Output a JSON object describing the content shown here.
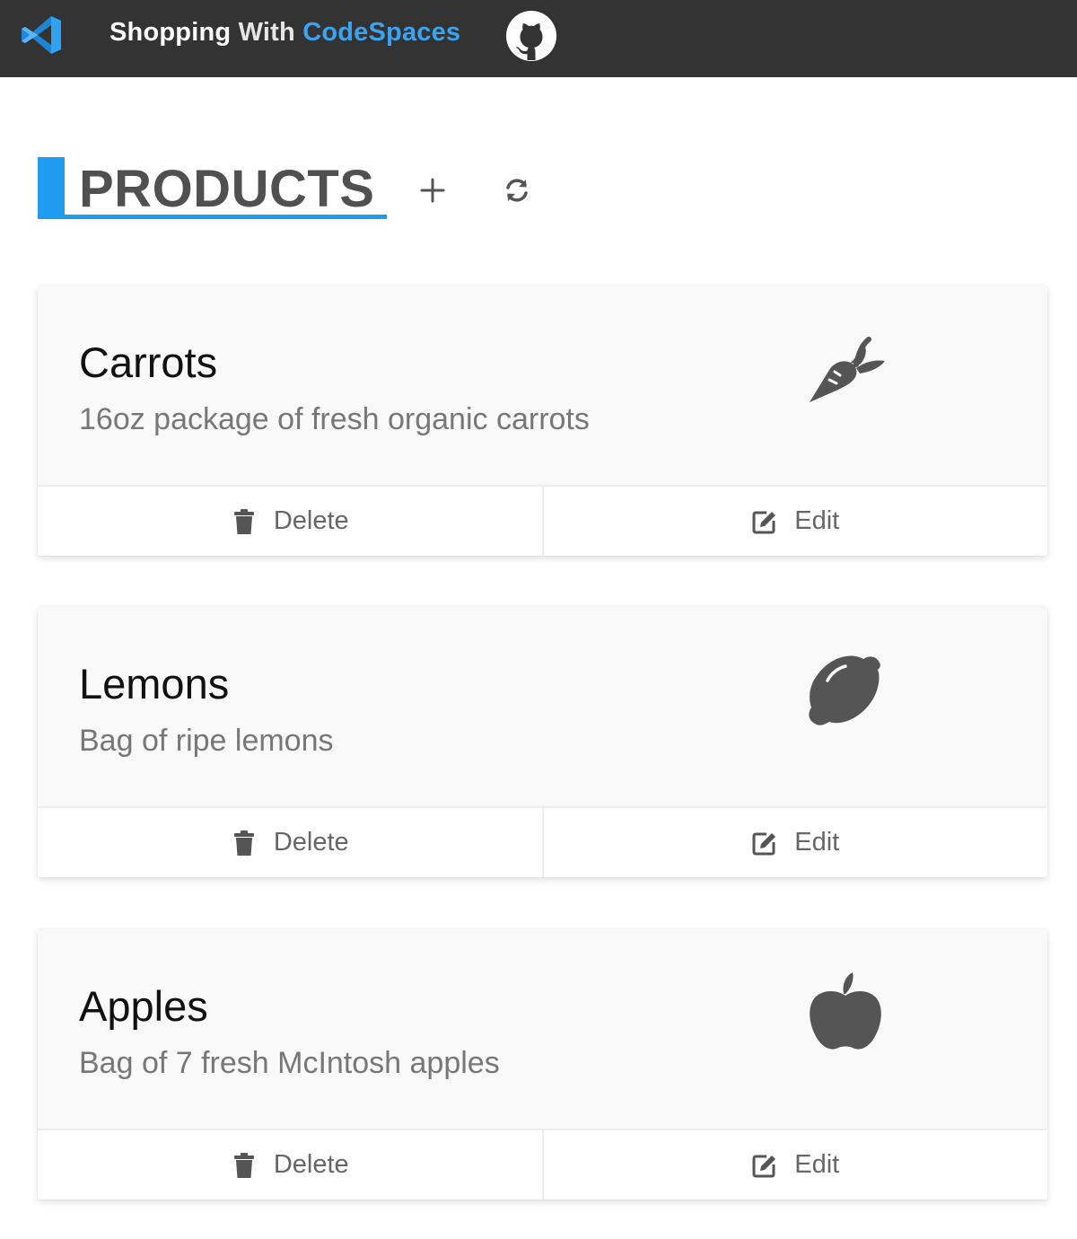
{
  "header": {
    "brand_part1": "Shopping",
    "brand_part2": "With",
    "brand_part3": "CodeSpaces",
    "brand_accent_color": "#3ba3f0",
    "logo_icon": "vscode-logo",
    "github_icon": "github-icon"
  },
  "page": {
    "title": "PRODUCTS",
    "accent_color": "#1f9cf0",
    "add_icon": "plus-icon",
    "refresh_icon": "refresh-icon"
  },
  "products": [
    {
      "name": "Carrots",
      "description": "16oz package of fresh organic carrots",
      "icon": "carrot-icon",
      "delete_label": "Delete",
      "edit_label": "Edit"
    },
    {
      "name": "Lemons",
      "description": "Bag of ripe lemons",
      "icon": "lemon-icon",
      "delete_label": "Delete",
      "edit_label": "Edit"
    },
    {
      "name": "Apples",
      "description": "Bag of 7 fresh McIntosh apples",
      "icon": "apple-icon",
      "delete_label": "Delete",
      "edit_label": "Edit"
    }
  ]
}
